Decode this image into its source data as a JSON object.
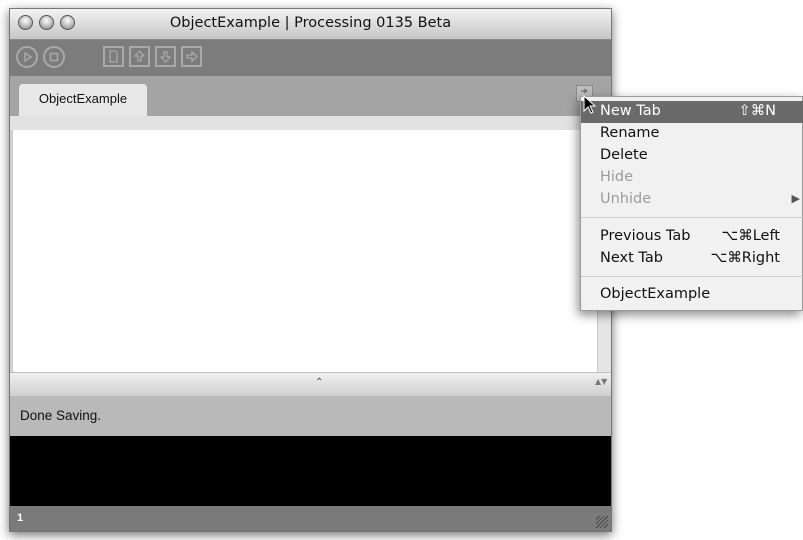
{
  "window": {
    "title": "ObjectExample | Processing 0135 Beta"
  },
  "toolbar": {
    "buttons": [
      "run-icon",
      "stop-icon",
      "new-icon",
      "open-icon",
      "save-icon",
      "export-icon"
    ]
  },
  "tabs": [
    {
      "label": "ObjectExample"
    }
  ],
  "status": {
    "message": "Done Saving."
  },
  "footer": {
    "line_number": "1"
  },
  "context_menu": {
    "items": [
      {
        "label": "New Tab",
        "shortcut": "⇧⌘N"
      },
      {
        "label": "Rename"
      },
      {
        "label": "Delete"
      },
      {
        "label": "Hide"
      },
      {
        "label": "Unhide"
      },
      {
        "label": "Previous Tab",
        "shortcut": "⌥⌘Left"
      },
      {
        "label": "Next Tab",
        "shortcut": "⌥⌘Right"
      },
      {
        "label": "ObjectExample"
      }
    ]
  },
  "colors": {
    "toolbar": "#7c7c7c",
    "tabbar": "#a4a4a4",
    "console": "#000000",
    "menu_highlight": "#6a6a6a"
  }
}
